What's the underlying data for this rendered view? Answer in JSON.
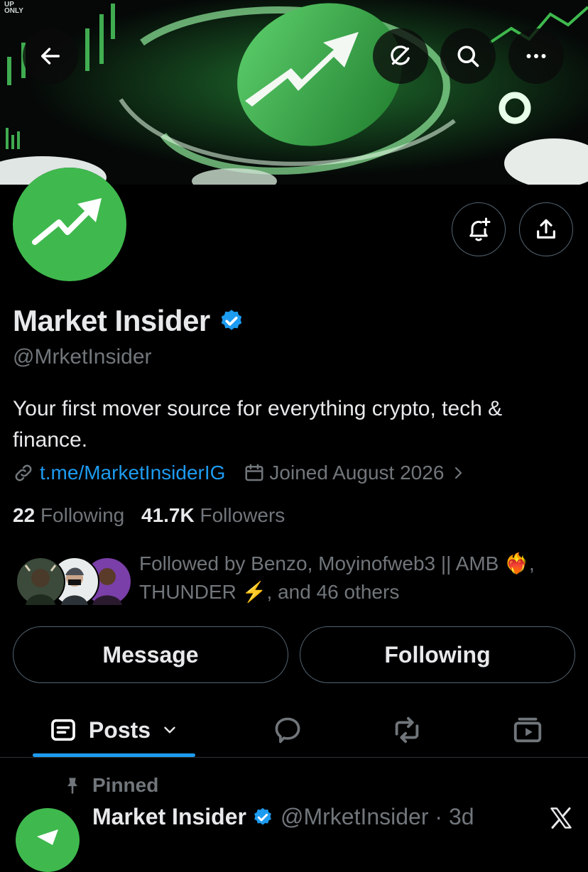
{
  "banner": {
    "corner_text_top": "UP",
    "corner_text_bottom": "ONLY"
  },
  "topbar": {
    "back_icon": "arrow-left-icon",
    "grok_icon": "grok-icon",
    "search_icon": "search-icon",
    "more_icon": "more-icon"
  },
  "profile": {
    "name": "Market Insider",
    "handle": "@MrketInsider",
    "bio": "Your first mover source for everything crypto, tech & finance.",
    "link": "t.me/MarketInsiderIG",
    "joined": "Joined August 2026",
    "following_count": "22",
    "following_label": "Following",
    "followers_count": "41.7K",
    "followers_label": "Followers",
    "followed_by_1": "Followed by Benzo, Moyinofweb3 || AMB ❤️‍🔥,",
    "followed_by_2": "THUNDER ⚡, and 46 others"
  },
  "actions": {
    "message": "Message",
    "following": "Following"
  },
  "tabs": {
    "posts": "Posts"
  },
  "post": {
    "pinned_label": "Pinned",
    "author": "Market Insider",
    "handle_time": "@MrketInsider · 3d"
  },
  "colors": {
    "accent": "#1d9bf0",
    "brand_green": "#3fb94e",
    "muted": "#71767b",
    "border": "#536471"
  }
}
